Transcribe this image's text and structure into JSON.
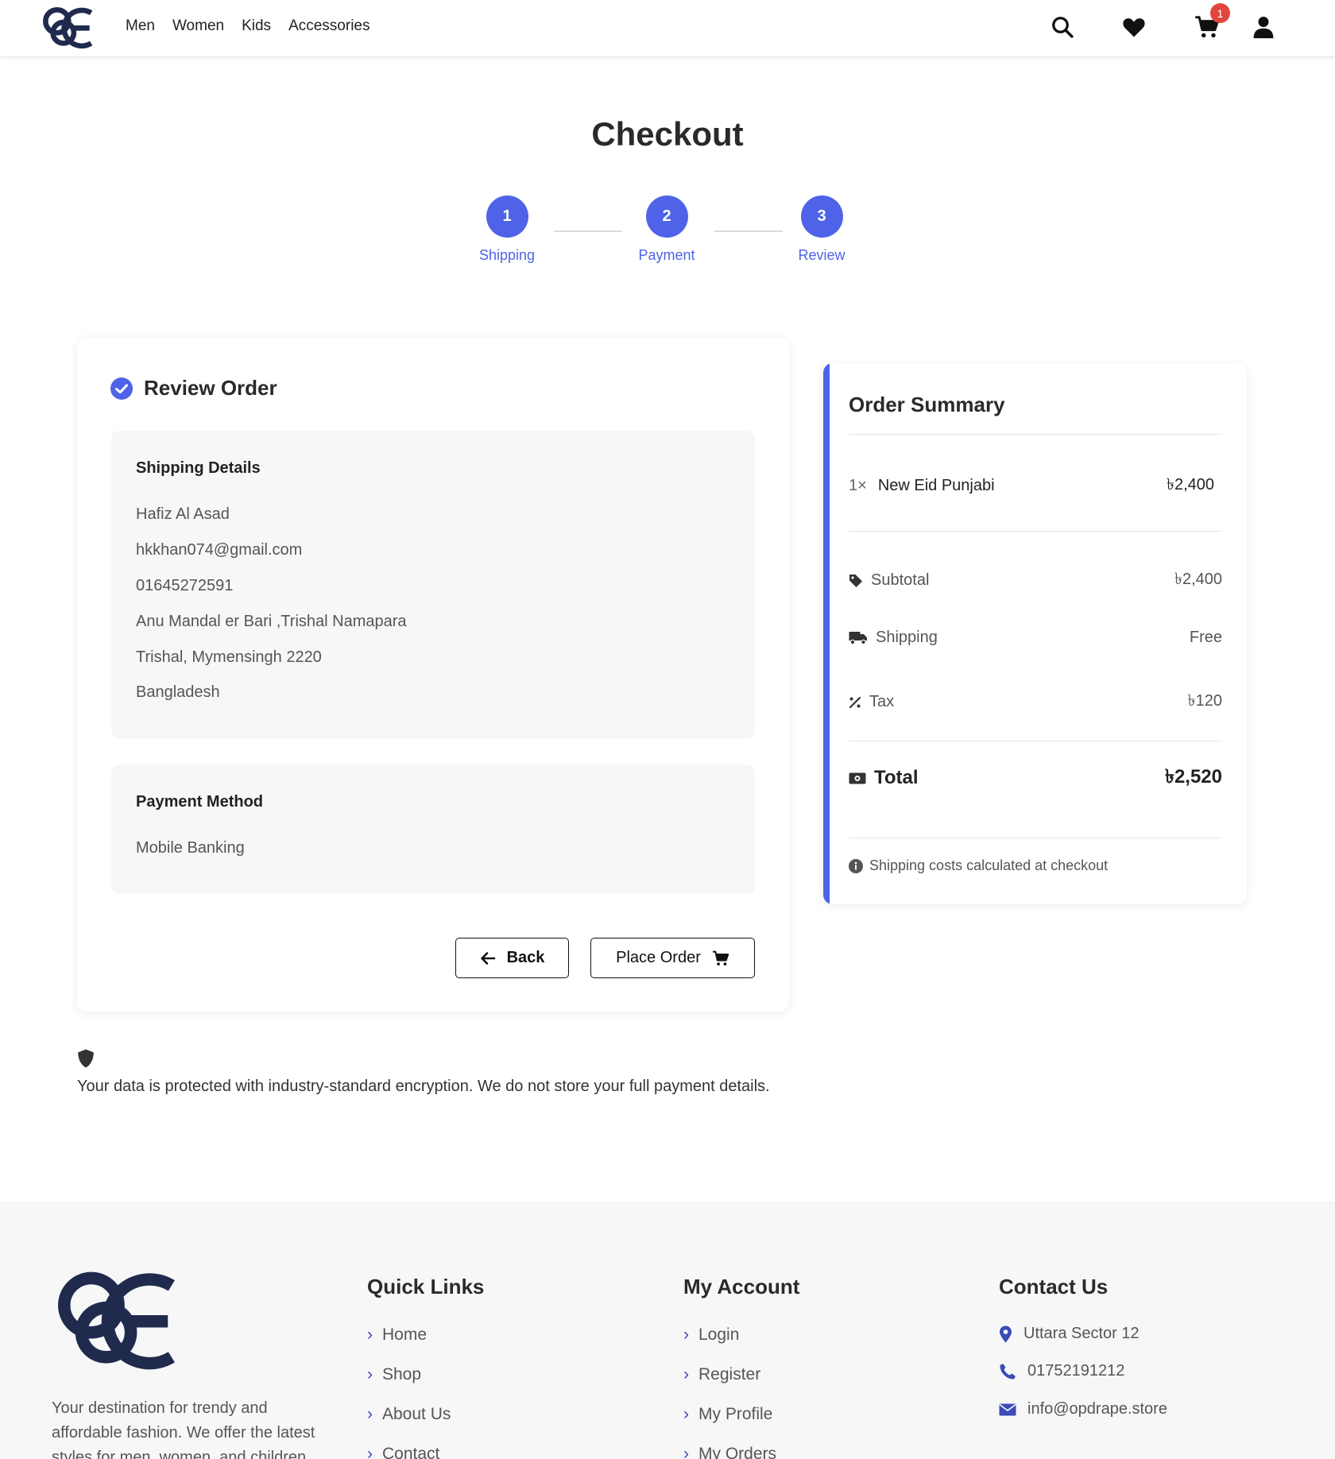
{
  "header": {
    "nav": [
      "Men",
      "Women",
      "Kids",
      "Accessories"
    ],
    "cart_count": "1"
  },
  "page": {
    "title": "Checkout"
  },
  "steps": [
    {
      "number": "1",
      "label": "Shipping"
    },
    {
      "number": "2",
      "label": "Payment"
    },
    {
      "number": "3",
      "label": "Review"
    }
  ],
  "review": {
    "title": "Review Order",
    "shipping": {
      "title": "Shipping Details",
      "lines": [
        "Hafiz Al Asad",
        "hkkhan074@gmail.com",
        "01645272591",
        "Anu Mandal er Bari ,Trishal Namapara",
        "Trishal, Mymensingh 2220",
        "Bangladesh"
      ]
    },
    "payment": {
      "title": "Payment Method",
      "value": "Mobile Banking"
    },
    "back_label": "Back",
    "place_order_label": "Place Order"
  },
  "security_note": "Your data is protected with industry-standard encryption. We do not store your full payment details.",
  "summary": {
    "title": "Order Summary",
    "item": {
      "qty": "1×",
      "name": "New Eid Punjabi",
      "price": "৳2,400"
    },
    "subtotal": {
      "label": "Subtotal",
      "value": "৳2,400"
    },
    "shipping": {
      "label": "Shipping",
      "value": "Free"
    },
    "tax": {
      "label": "Tax",
      "value": "৳120"
    },
    "total": {
      "label": "Total",
      "value": "৳2,520"
    },
    "note": "Shipping costs calculated at checkout",
    "accent_color": "#4e63e8"
  },
  "footer": {
    "description": "Your destination for trendy and affordable fashion. We offer the latest styles for men, women, and children",
    "quick_links": {
      "title": "Quick Links",
      "items": [
        "Home",
        "Shop",
        "About Us",
        "Contact"
      ]
    },
    "my_account": {
      "title": "My Account",
      "items": [
        "Login",
        "Register",
        "My Profile",
        "My Orders"
      ]
    },
    "contact": {
      "title": "Contact Us",
      "address": "Uttara Sector 12",
      "phone": "01752191212",
      "email": "info@opdrape.store"
    }
  },
  "icons": [
    "search-icon",
    "heart-icon",
    "cart-icon",
    "user-icon",
    "check-circle-icon",
    "arrow-left-icon",
    "tag-icon",
    "truck-icon",
    "percent-icon",
    "money-icon",
    "info-icon",
    "shield-icon",
    "chevron-right-icon",
    "map-pin-icon",
    "phone-icon",
    "envelope-icon"
  ]
}
